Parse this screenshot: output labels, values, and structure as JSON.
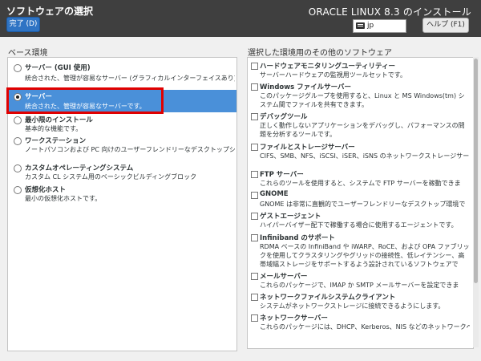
{
  "header": {
    "title": "ソフトウェアの選択",
    "done_label": "完了 (D)",
    "product": "ORACLE LINUX 8.3 のインストール",
    "keyboard_layout": "jp",
    "help_label": "ヘルプ (F1)"
  },
  "base_env": {
    "label": "ベース環境",
    "items": [
      {
        "title": "サーバー (GUI 使用)",
        "desc": "統合された、管理が容易なサーバー (グラフィカルインターフェイスあり) で",
        "selected": false
      },
      {
        "title": "サーバー",
        "desc": "統合された、管理が容易なサーバーです。",
        "selected": true
      },
      {
        "title": "最小限のインストール",
        "desc": "基本的な機能です。",
        "selected": false
      },
      {
        "title": "ワークステーション",
        "desc": "ノートパソコンおよび PC 向けのユーザーフレンドリーなデスクトップシス",
        "selected": false
      },
      {
        "title": "カスタムオペレーティングシステム",
        "desc": "カスタム CL システム用のベーシックビルディングブロック",
        "selected": false
      },
      {
        "title": "仮想化ホスト",
        "desc": "最小の仮想化ホストです。",
        "selected": false
      }
    ]
  },
  "addons": {
    "label": "選択した環境用のその他のソフトウェア",
    "items": [
      {
        "title": "ハードウェアモニタリングユーティリティー",
        "desc": "サーバーハードウェアの監視用ツールセットです。"
      },
      {
        "title": "Windows ファイルサーバー",
        "desc": "このパッケージグループを使用すると、Linux と MS Windows(tm) システム間でファイルを共有できます。"
      },
      {
        "title": "デバッグツール",
        "desc": "正しく動作しないアプリケーションをデバッグし、パフォーマンスの問題を分析するツールです。"
      },
      {
        "title": "ファイルとストレージサーバー",
        "desc": "CIFS、SMB、NFS、iSCSI、iSER、iSNS のネットワークストレージサーバーです。"
      },
      {
        "title": "FTP サーバー",
        "desc": "これらのツールを使用すると、システムで FTP サーバーを稼動できます。"
      },
      {
        "title": "GNOME",
        "desc": "GNOME は非常に直観的でユーザーフレンドリーなデスクトップ環境です。"
      },
      {
        "title": "ゲストエージェント",
        "desc": "ハイパーバイザー配下で稼働する場合に使用するエージェントです。"
      },
      {
        "title": "Infiniband のサポート",
        "desc": "RDMA ベースの InfiniBand や iWARP、RoCE、および OPA ファブリックを使用してクラスタリングやグリッドの接続性、低レイテンシー、高帯域幅ストレージをサポートするよう設計されているソフトウェアです。"
      },
      {
        "title": "メールサーバー",
        "desc": "これらのパッケージで、IMAP か SMTP メールサーバーを設定できます。"
      },
      {
        "title": "ネットワークファイルシステムクライアント",
        "desc": "システムがネットワークストレージに接続できるようにします。"
      },
      {
        "title": "ネットワークサーバー",
        "desc": "これらのパッケージには、DHCP、Kerberos、NIS などのネットワークベー"
      }
    ]
  }
}
